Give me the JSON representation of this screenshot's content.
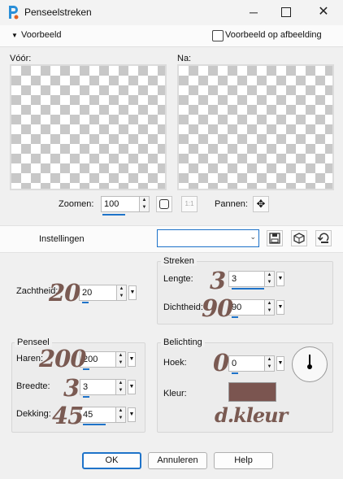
{
  "window": {
    "title": "Penseelstreken"
  },
  "preview": {
    "toggle_label": "Voorbeeld",
    "on_image_label": "Voorbeeld op afbeelding",
    "before_label": "Vóór:",
    "after_label": "Na:",
    "zoom_label": "Zoomen:",
    "zoom_value": "100",
    "one_to_one": "1:1",
    "pan_label": "Pannen:"
  },
  "settings": {
    "label": "Instellingen",
    "preset_value": ""
  },
  "softness": {
    "label": "Zachtheid:",
    "value": "20",
    "annotation": "20"
  },
  "strokes": {
    "title": "Streken",
    "length_label": "Lengte:",
    "length_value": "3",
    "length_annotation": "3",
    "density_label": "Dichtheid:",
    "density_value": "90",
    "density_annotation": "90"
  },
  "brush": {
    "title": "Penseel",
    "hairs_label": "Haren:",
    "hairs_value": "200",
    "hairs_annotation": "200",
    "width_label": "Breedte:",
    "width_value": "3",
    "width_annotation": "3",
    "opacity_label": "Dekking:",
    "opacity_value": "45",
    "opacity_annotation": "45"
  },
  "lighting": {
    "title": "Belichting",
    "angle_label": "Hoek:",
    "angle_value": "0",
    "angle_annotation": "0",
    "color_label": "Kleur:",
    "color_value": "#7b5550",
    "color_annotation": "d.kleur"
  },
  "buttons": {
    "ok": "OK",
    "cancel": "Annuleren",
    "help": "Help"
  },
  "colors": {
    "accent": "#1e73c9",
    "annotation": "#7a5a52",
    "swatch": "#7b5550"
  }
}
